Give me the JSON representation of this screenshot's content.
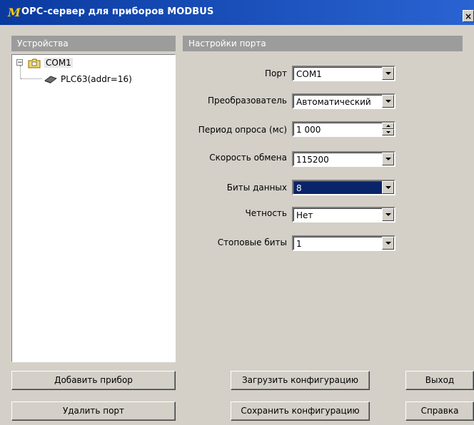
{
  "window": {
    "title": "OPC-сервер для приборов MODBUS",
    "close_glyph": "×",
    "icon": "modbus-logo-icon",
    "icon_glyph": "M"
  },
  "devices_panel": {
    "header": "Устройства",
    "tree": {
      "expander_glyph": "−",
      "port": {
        "label": "COM1",
        "icon": "folder-icon"
      },
      "device": {
        "label": "PLC63(addr=16)",
        "icon": "device-icon"
      }
    }
  },
  "settings_panel": {
    "header": "Настройки порта",
    "fields": {
      "port": {
        "label": "Порт",
        "value": "COM1"
      },
      "converter": {
        "label": "Преобразователь",
        "value": "Автоматический"
      },
      "poll_period": {
        "label": "Период опроса (мс)",
        "value": "1 000"
      },
      "baud_rate": {
        "label": "Скорость обмена",
        "value": "115200"
      },
      "data_bits": {
        "label": "Биты данных",
        "value": "8"
      },
      "parity": {
        "label": "Четность",
        "value": "Нет"
      },
      "stop_bits": {
        "label": "Стоповые биты",
        "value": "1"
      }
    }
  },
  "buttons": {
    "add_device": "Добавить прибор",
    "delete_port": "Удалить порт",
    "load_config": "Загрузить конфигурацию",
    "save_config": "Сохранить конфигурацию",
    "exit": "Выход",
    "help": "Справка"
  },
  "colors": {
    "title_bar": "#1f50b5",
    "panel_header": "#9c9c9c",
    "selection": "#0a246a",
    "window_bg": "#d4d0c8"
  }
}
